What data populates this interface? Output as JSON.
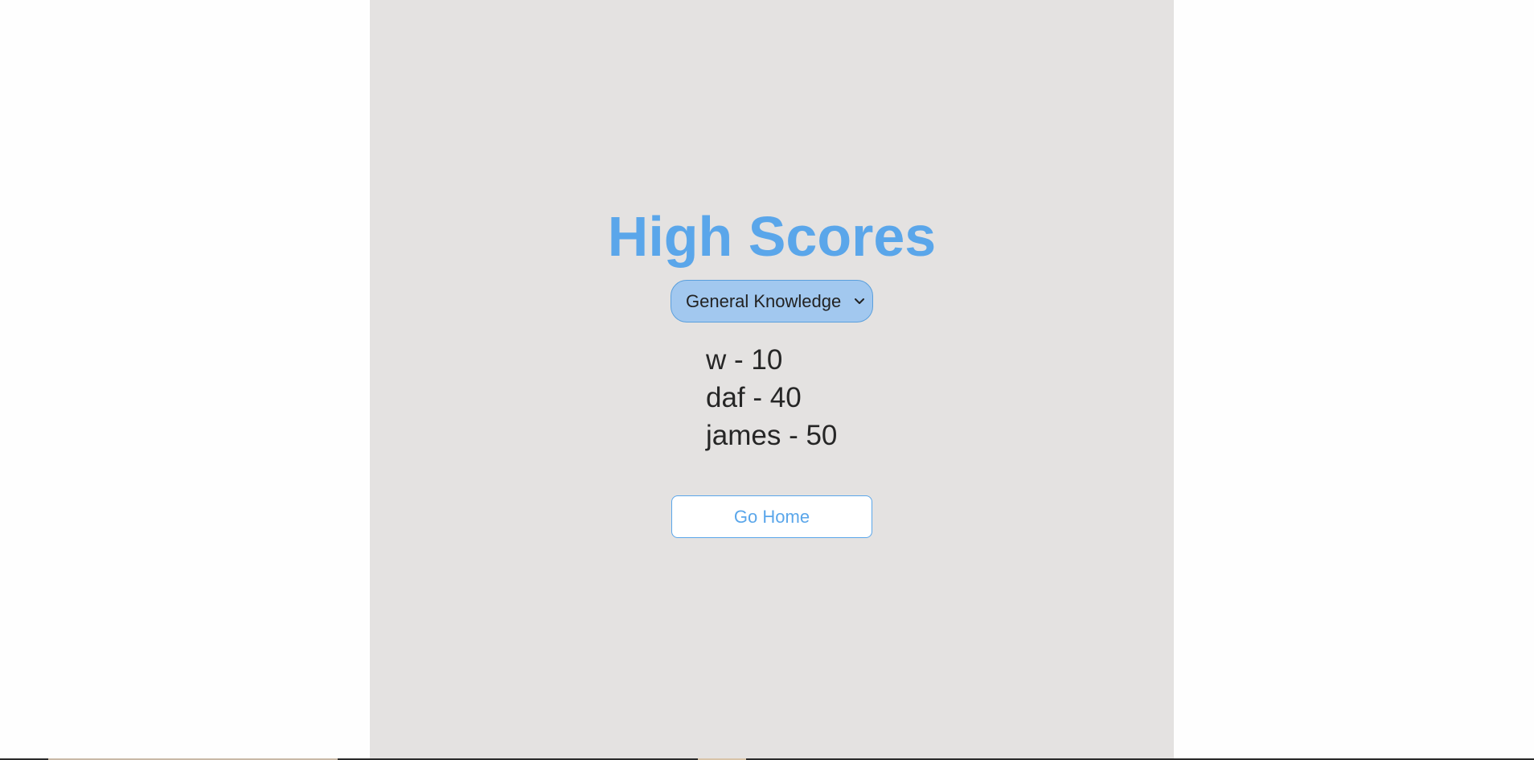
{
  "page": {
    "title": "High Scores"
  },
  "category_select": {
    "selected": "General Knowledge",
    "icon": "chevron-down-icon"
  },
  "scores": [
    {
      "text": "w - 10"
    },
    {
      "text": "daf - 40"
    },
    {
      "text": "james - 50"
    }
  ],
  "actions": {
    "go_home_label": "Go Home"
  },
  "colors": {
    "accent": "#5aa6ea",
    "panel_background": "#e4e2e1",
    "select_background": "#a2c8ef",
    "text": "#262626"
  }
}
